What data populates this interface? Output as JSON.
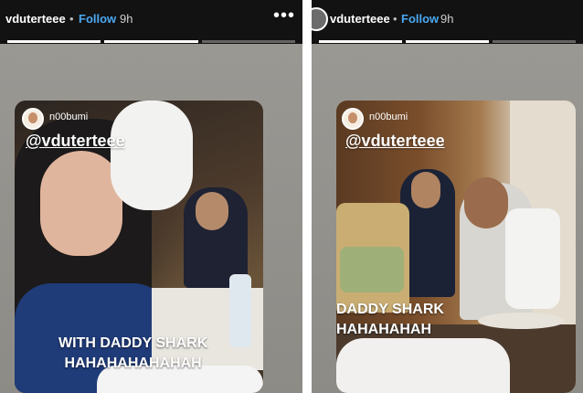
{
  "stories": [
    {
      "header": {
        "username": "vduterteee",
        "separator": "•",
        "follow_label": "Follow",
        "time": "9h",
        "more_icon": "more-horizontal-icon"
      },
      "card": {
        "poster_name": "n00bumi",
        "mention": "@vduterteee",
        "caption_line1": "WITH DADDY SHARK",
        "caption_line2": "HAHAHAHAHAHAH"
      }
    },
    {
      "header": {
        "username": "vduterteee",
        "separator": "•",
        "follow_label": "Follow",
        "time": "9h"
      },
      "card": {
        "poster_name": "n00bumi",
        "mention": "@vduterteee",
        "caption_line1": "DADDY SHARK",
        "caption_line2": "HAHAHAHAH"
      }
    }
  ],
  "colors": {
    "follow": "#4aa8f0",
    "topbar": "#121212",
    "story_background": "#8f8d88"
  }
}
